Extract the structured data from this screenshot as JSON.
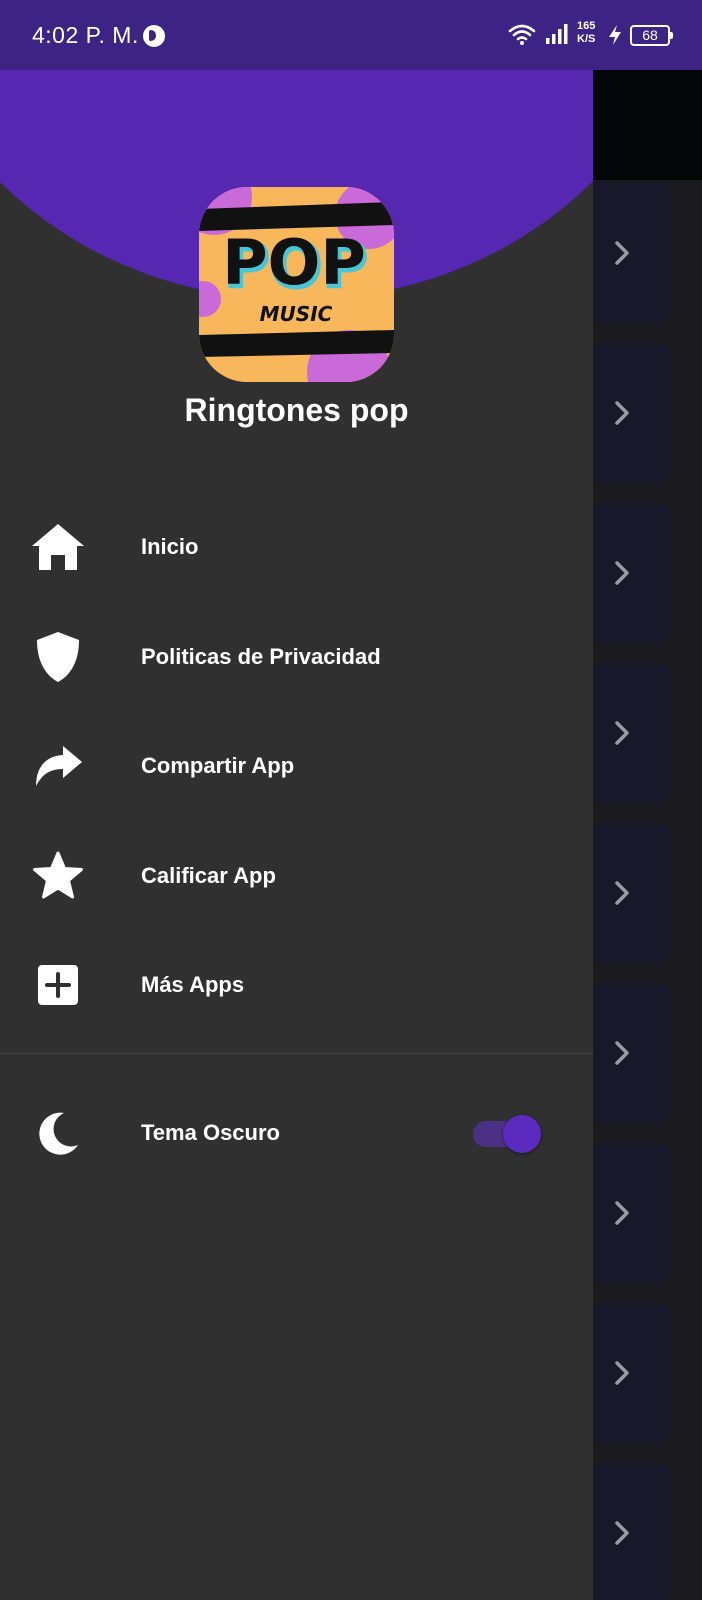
{
  "status_bar": {
    "time": "4:02 P. M.",
    "net_speed_value": "165",
    "net_speed_unit": "K/S",
    "battery": "68"
  },
  "drawer": {
    "app_title": "Ringtones pop",
    "logo": {
      "line1": "POP",
      "line2": "MUSIC"
    },
    "menu": [
      {
        "label": "Inicio",
        "icon": "home-icon"
      },
      {
        "label": "Politicas de Privacidad",
        "icon": "shield-icon"
      },
      {
        "label": "Compartir App",
        "icon": "share-icon"
      },
      {
        "label": "Calificar App",
        "icon": "star-icon"
      },
      {
        "label": "Más Apps",
        "icon": "plus-square-icon"
      }
    ],
    "theme": {
      "label": "Tema Oscuro",
      "icon": "moon-icon",
      "enabled": true
    }
  },
  "colors": {
    "accent": "#5628b2",
    "status_bar": "#3d2383",
    "drawer_bg": "#303030",
    "background": "#050608",
    "card_bg": "#18182a"
  }
}
